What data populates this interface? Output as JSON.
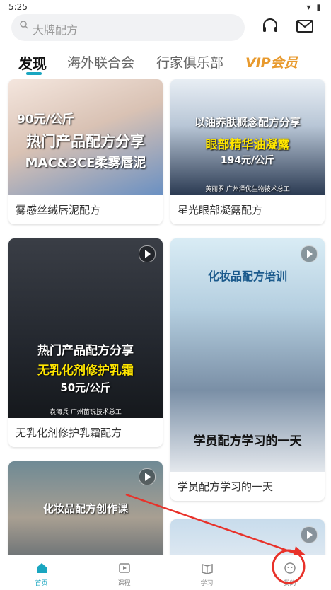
{
  "status_bar": {
    "time": "5:25",
    "icons": "▾ ▮"
  },
  "search": {
    "placeholder": "大牌配方"
  },
  "tabs": [
    {
      "label": "发现"
    },
    {
      "label": "海外联合会"
    },
    {
      "label": "行家俱乐部"
    },
    {
      "label": "VIP会员"
    }
  ],
  "cards": [
    {
      "caption": "雾感丝绒唇泥配方",
      "overlay": [
        "90元/公斤",
        "热门产品配方分享",
        "MAC&3CE柔雾唇泥"
      ]
    },
    {
      "caption": "星光眼部凝露配方",
      "overlay": [
        "以油养肤概念配方分享",
        "眼部精华油凝露",
        "194元/公斤",
        "黄丽罗 广州泽优生物技术总工"
      ]
    },
    {
      "caption": "无乳化剂修护乳霜配方",
      "overlay": [
        "热门产品配方分享",
        "无乳化剂修护乳霜",
        "50元/公斤",
        "袁海兵 广州苗锐技术总工"
      ]
    },
    {
      "caption": "学员配方学习的一天",
      "overlay": [
        "化妆品配方培训",
        "学员配方学习的一天"
      ]
    },
    {
      "caption": "",
      "overlay": [
        "化妆品配方创作课"
      ]
    },
    {
      "caption": "",
      "overlay": []
    }
  ],
  "nav": [
    {
      "label": "首页"
    },
    {
      "label": "课程"
    },
    {
      "label": "学习"
    },
    {
      "label": "我的"
    }
  ],
  "colors": {
    "accent": "#1aa6c0",
    "vip": "#e89a2e",
    "annotation": "#e8322a"
  }
}
